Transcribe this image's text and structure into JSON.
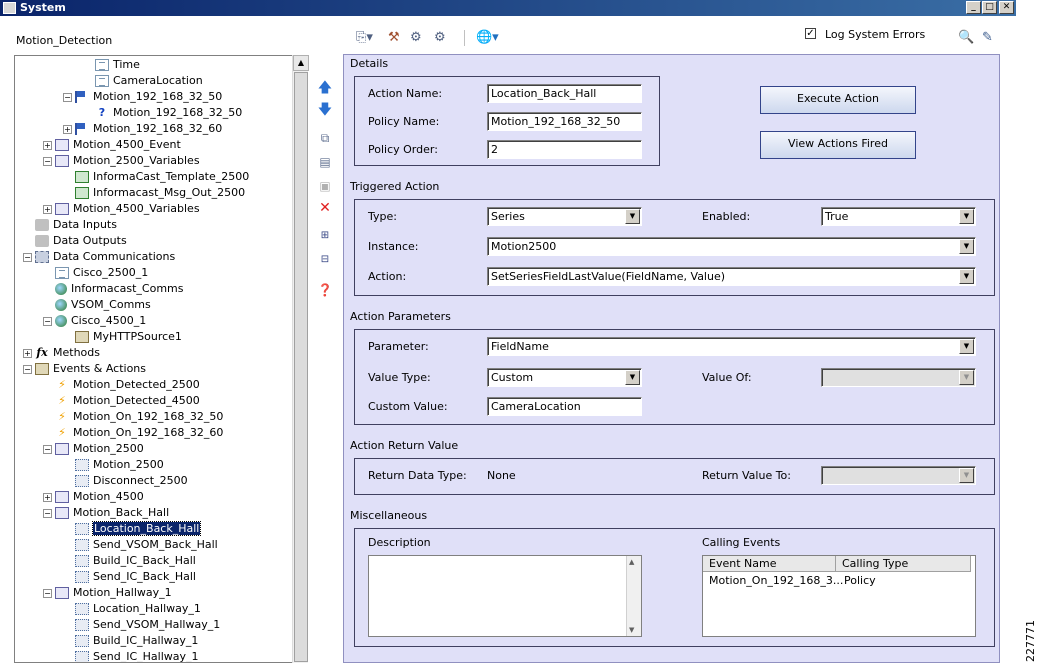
{
  "window": {
    "title": "System"
  },
  "tree": {
    "context_label": "Motion_Detection",
    "nodes": [
      {
        "label": "Time",
        "icon": "document-icon"
      },
      {
        "label": "CameraLocation",
        "icon": "document-icon"
      },
      {
        "label": "Motion_192_168_32_50",
        "icon": "flag-icon"
      },
      {
        "label": "Motion_192_168_32_50",
        "icon": "question-icon"
      },
      {
        "label": "Motion_192_168_32_60",
        "icon": "flag-icon"
      },
      {
        "label": "Motion_4500_Event",
        "icon": "schedule-icon"
      },
      {
        "label": "Motion_2500_Variables",
        "icon": "schedule-icon"
      },
      {
        "label": "InformaCast_Template_2500",
        "icon": "table-icon"
      },
      {
        "label": "Informacast_Msg_Out_2500",
        "icon": "table-icon"
      },
      {
        "label": "Motion_4500_Variables",
        "icon": "schedule-icon"
      },
      {
        "label": "Data Inputs",
        "icon": "data-input-icon"
      },
      {
        "label": "Data Outputs",
        "icon": "data-output-icon"
      },
      {
        "label": "Data Communications",
        "icon": "network-icon"
      },
      {
        "label": "Cisco_2500_1",
        "icon": "document-icon"
      },
      {
        "label": "Informacast_Comms",
        "icon": "globe-icon"
      },
      {
        "label": "VSOM_Comms",
        "icon": "globe-icon"
      },
      {
        "label": "Cisco_4500_1",
        "icon": "globe-icon"
      },
      {
        "label": "MyHTTPSource1",
        "icon": "gear-icon"
      },
      {
        "label": "Methods",
        "icon": "fx-icon"
      },
      {
        "label": "Events & Actions",
        "icon": "events-icon"
      },
      {
        "label": "Motion_Detected_2500",
        "icon": "lightning-icon"
      },
      {
        "label": "Motion_Detected_4500",
        "icon": "lightning-icon"
      },
      {
        "label": "Motion_On_192_168_32_50",
        "icon": "lightning-icon"
      },
      {
        "label": "Motion_On_192_168_32_60",
        "icon": "lightning-icon"
      },
      {
        "label": "Motion_2500",
        "icon": "schedule-icon"
      },
      {
        "label": "Motion_2500",
        "icon": "action-icon"
      },
      {
        "label": "Disconnect_2500",
        "icon": "action-icon"
      },
      {
        "label": "Motion_4500",
        "icon": "schedule-icon"
      },
      {
        "label": "Motion_Back_Hall",
        "icon": "schedule-icon"
      },
      {
        "label": "Location_Back_Hall",
        "icon": "action-icon"
      },
      {
        "label": "Send_VSOM_Back_Hall",
        "icon": "action-icon"
      },
      {
        "label": "Build_IC_Back_Hall",
        "icon": "action-icon"
      },
      {
        "label": "Send_IC_Back_Hall",
        "icon": "action-icon"
      },
      {
        "label": "Motion_Hallway_1",
        "icon": "schedule-icon"
      },
      {
        "label": "Location_Hallway_1",
        "icon": "action-icon"
      },
      {
        "label": "Send_VSOM_Hallway_1",
        "icon": "action-icon"
      },
      {
        "label": "Build_IC_Hallway_1",
        "icon": "action-icon"
      },
      {
        "label": "Send_IC_Hallway_1",
        "icon": "action-icon"
      }
    ]
  },
  "toolbar": {
    "log_errors_label": "Log System Errors",
    "log_errors_checked": true
  },
  "details": {
    "section_label": "Details",
    "action_name_label": "Action Name:",
    "action_name": "Location_Back_Hall",
    "policy_name_label": "Policy Name:",
    "policy_name": "Motion_192_168_32_50",
    "policy_order_label": "Policy Order:",
    "policy_order": "2",
    "execute_button": "Execute Action",
    "view_button": "View Actions Fired"
  },
  "triggered": {
    "section_label": "Triggered Action",
    "type_label": "Type:",
    "type": "Series",
    "enabled_label": "Enabled:",
    "enabled": "True",
    "instance_label": "Instance:",
    "instance": "Motion2500",
    "action_label": "Action:",
    "action": "SetSeriesFieldLastValue(FieldName, Value)"
  },
  "parameters": {
    "section_label": "Action Parameters",
    "parameter_label": "Parameter:",
    "parameter": "FieldName",
    "value_type_label": "Value Type:",
    "value_type": "Custom",
    "value_of_label": "Value Of:",
    "value_of": "",
    "custom_value_label": "Custom Value:",
    "custom_value": "CameraLocation"
  },
  "return_value": {
    "section_label": "Action Return Value",
    "data_type_label": "Return Data Type:",
    "data_type": "None",
    "return_to_label": "Return Value To:",
    "return_to": ""
  },
  "misc": {
    "section_label": "Miscellaneous",
    "description_label": "Description",
    "calling_events_label": "Calling Events",
    "columns": [
      "Event Name",
      "Calling Type"
    ],
    "rows": [
      [
        "Motion_On_192_168_3...",
        "Policy"
      ]
    ]
  },
  "figure_id": "227771"
}
